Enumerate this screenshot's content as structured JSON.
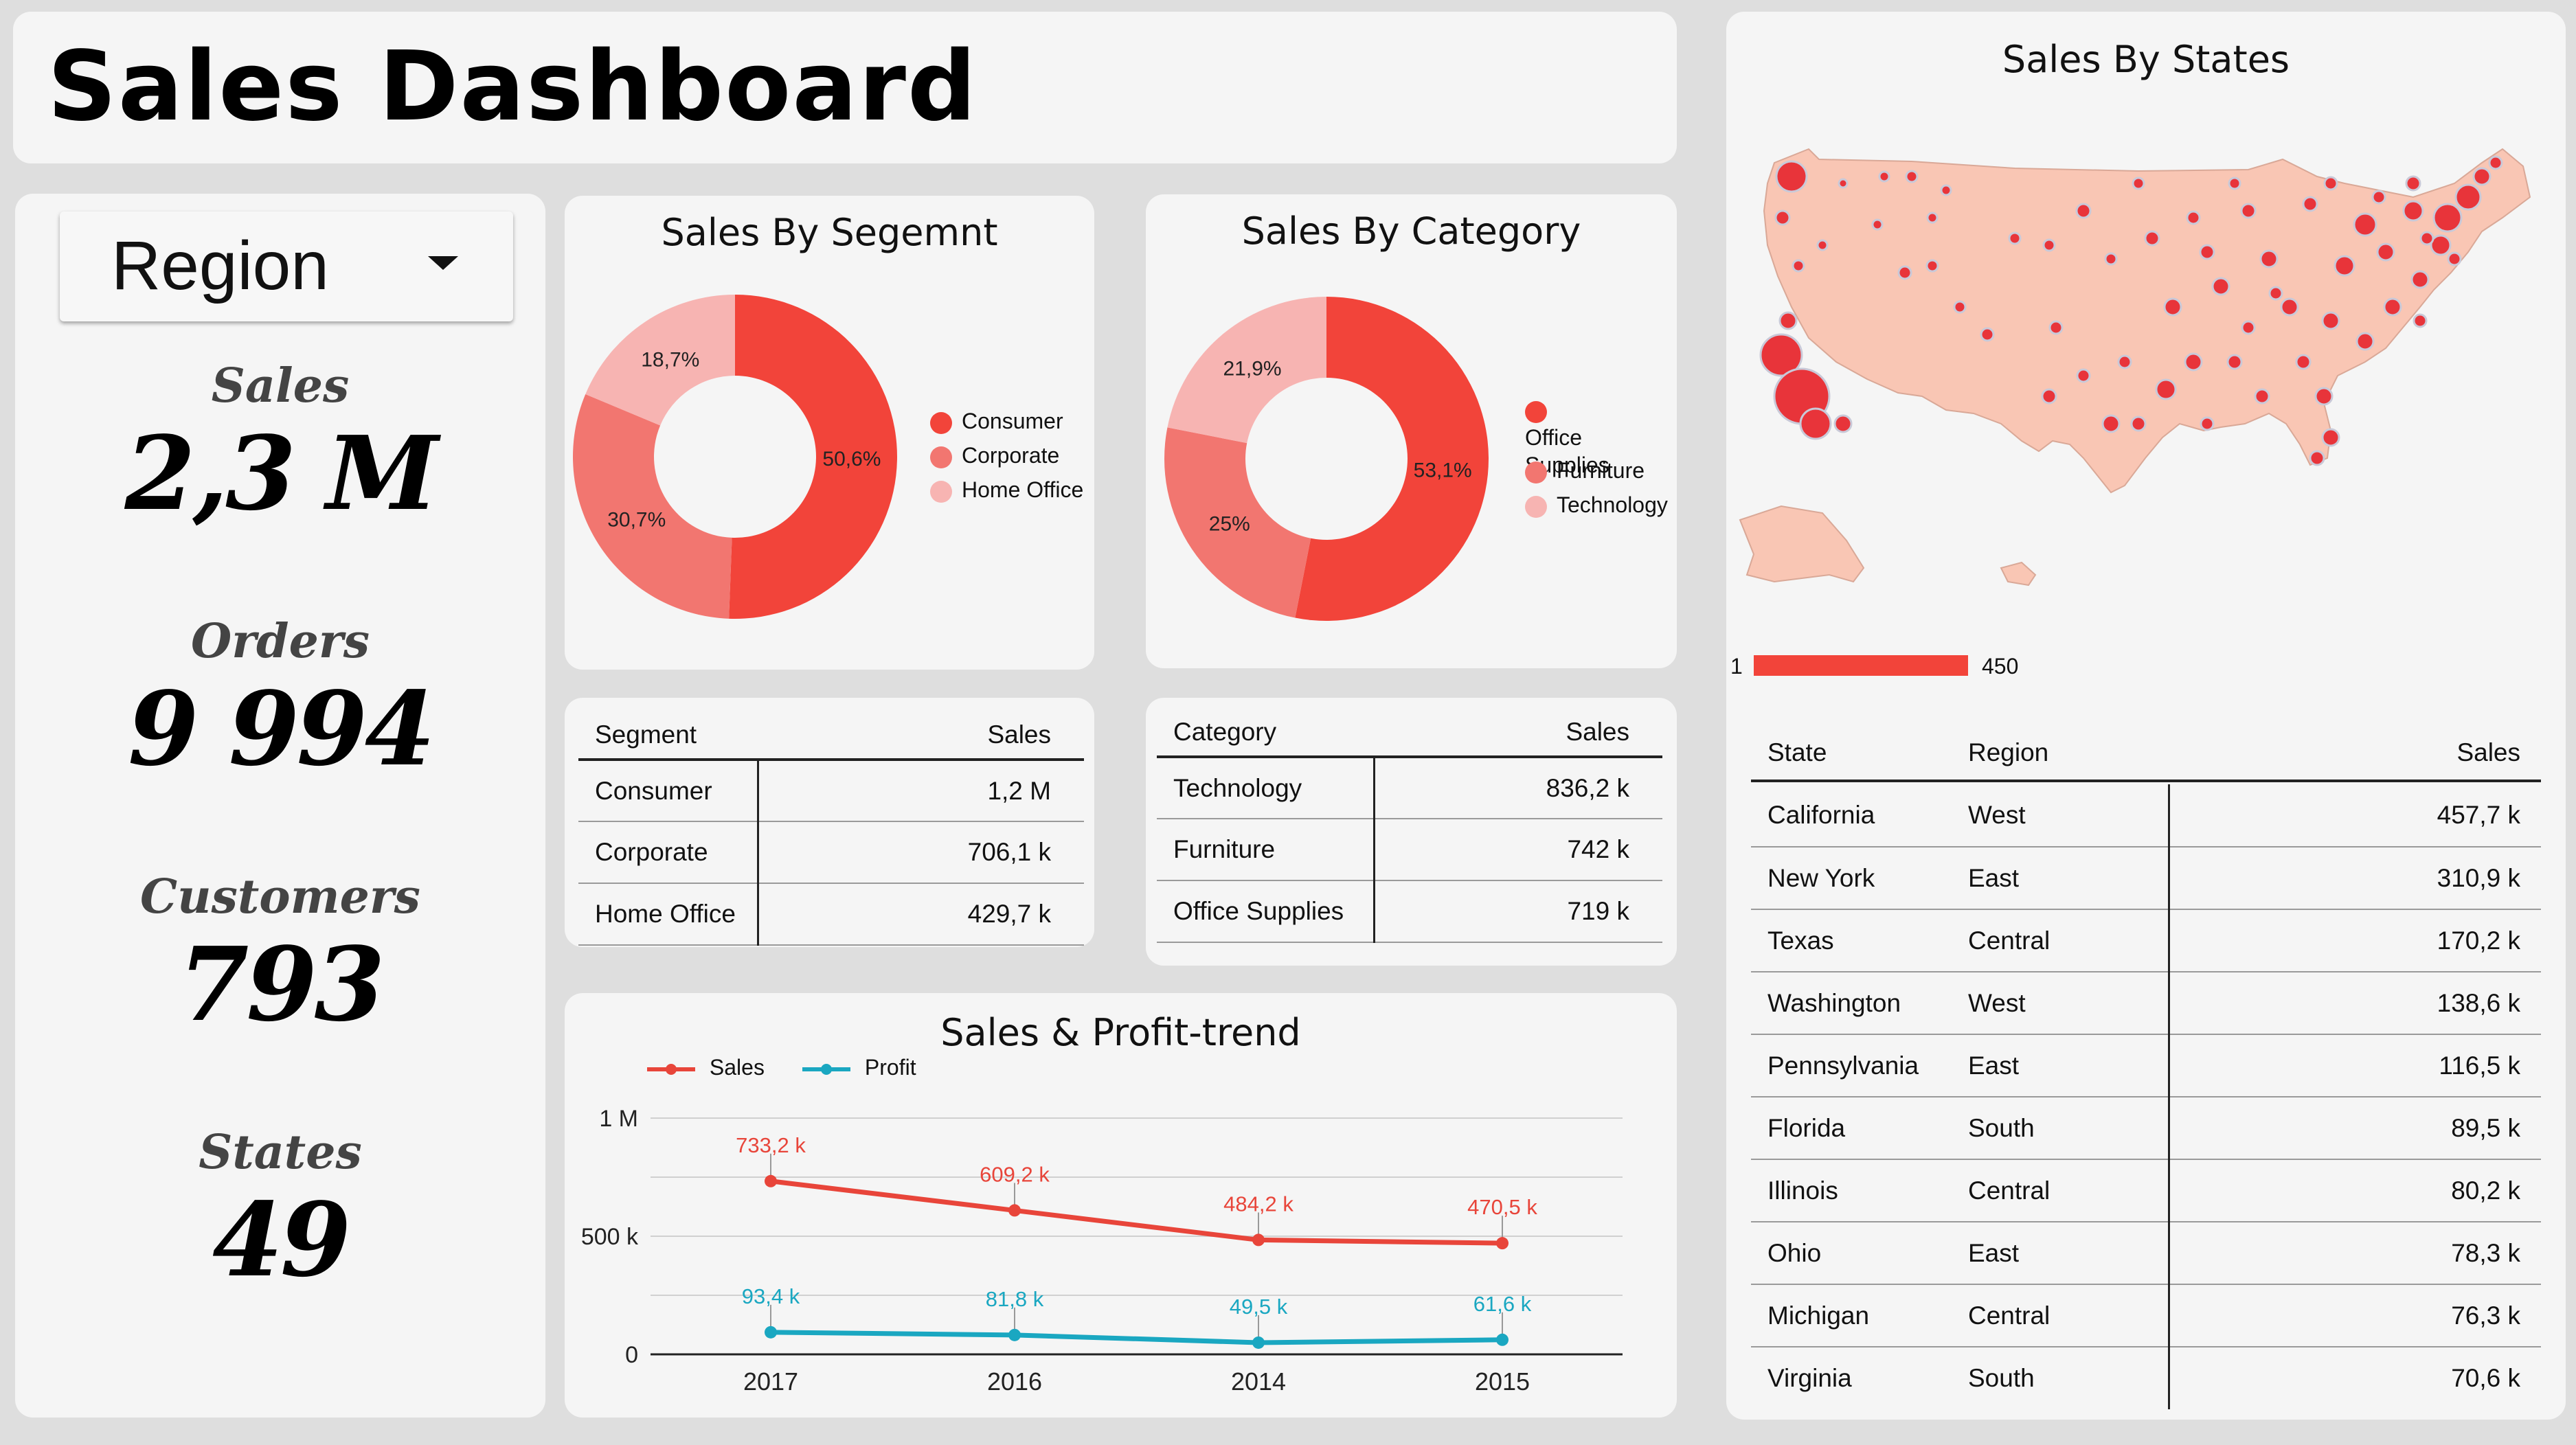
{
  "header": {
    "title": "Sales Dashboard"
  },
  "filter": {
    "label": "Region"
  },
  "kpis": [
    {
      "label": "Sales",
      "value": "2,3 M"
    },
    {
      "label": "Orders",
      "value": "9 994"
    },
    {
      "label": "Customers",
      "value": "793"
    },
    {
      "label": "States",
      "value": "49"
    }
  ],
  "segment_panel": {
    "title": "Sales By Segemnt",
    "legend": [
      "Consumer",
      "Corporate",
      "Home Office"
    ],
    "table": {
      "headers": [
        "Segment",
        "Sales"
      ],
      "rows": [
        [
          "Consumer",
          "1,2 M"
        ],
        [
          "Corporate",
          "706,1 k"
        ],
        [
          "Home Office",
          "429,7 k"
        ]
      ]
    }
  },
  "category_panel": {
    "title": "Sales By Category",
    "legend": [
      "Office Supplies",
      "Furniture",
      "Technology"
    ],
    "table": {
      "headers": [
        "Category",
        "Sales"
      ],
      "rows": [
        [
          "Technology",
          "836,2 k"
        ],
        [
          "Furniture",
          "742 k"
        ],
        [
          "Office Supplies",
          "719 k"
        ]
      ]
    }
  },
  "trend_panel": {
    "title": "Sales & Profit-trend",
    "legend": [
      "Sales",
      "Profit"
    ]
  },
  "map_panel": {
    "title": "Sales By States",
    "scale_min": "1",
    "scale_max": "450",
    "table": {
      "headers": [
        "State",
        "Region",
        "Sales"
      ],
      "rows": [
        [
          "California",
          "West",
          "457,7 k"
        ],
        [
          "New York",
          "East",
          "310,9 k"
        ],
        [
          "Texas",
          "Central",
          "170,2 k"
        ],
        [
          "Washington",
          "West",
          "138,6 k"
        ],
        [
          "Pennsylvania",
          "East",
          "116,5 k"
        ],
        [
          "Florida",
          "South",
          "89,5 k"
        ],
        [
          "Illinois",
          "Central",
          "80,2 k"
        ],
        [
          "Ohio",
          "East",
          "78,3 k"
        ],
        [
          "Michigan",
          "Central",
          "76,3 k"
        ],
        [
          "Virginia",
          "South",
          "70,6 k"
        ]
      ]
    }
  },
  "colors": {
    "consumer": "#f2443a",
    "corporate": "#f27670",
    "home_office": "#f7b4b2",
    "sales_line": "#e8453a",
    "profit_line": "#1aa7c1",
    "map_fill": "#f9c6b4",
    "map_dot": "#e8343a"
  },
  "chart_data": [
    {
      "type": "pie",
      "title": "Sales By Segemnt",
      "categories": [
        "Consumer",
        "Corporate",
        "Home Office"
      ],
      "values": [
        50.6,
        30.7,
        18.7
      ],
      "labels": [
        "50,6%",
        "30,7%",
        "18,7%"
      ],
      "colors": [
        "#f2443a",
        "#f27670",
        "#f7b4b2"
      ],
      "donut": true
    },
    {
      "type": "pie",
      "title": "Sales By Category",
      "categories": [
        "Office Supplies",
        "Furniture",
        "Technology"
      ],
      "values": [
        53.1,
        25,
        21.9
      ],
      "labels": [
        "53,1%",
        "25%",
        "21,9%"
      ],
      "colors": [
        "#f2443a",
        "#f27670",
        "#f7b4b2"
      ],
      "donut": true
    },
    {
      "type": "line",
      "title": "Sales & Profit-trend",
      "x": [
        "2017",
        "2016",
        "2014",
        "2015"
      ],
      "series": [
        {
          "name": "Sales",
          "values": [
            733.2,
            609.2,
            484.2,
            470.5
          ],
          "labels": [
            "733,2 k",
            "609,2 k",
            "484,2 k",
            "470,5 k"
          ],
          "color": "#e8453a"
        },
        {
          "name": "Profit",
          "values": [
            93.4,
            81.8,
            49.5,
            61.6
          ],
          "labels": [
            "93,4 k",
            "81,8 k",
            "49,5 k",
            "61,6 k"
          ],
          "color": "#1aa7c1"
        }
      ],
      "yticks": [
        "0",
        "500 k",
        "1 M"
      ],
      "ylim": [
        0,
        1000
      ],
      "grid": true,
      "legend": "top-left"
    }
  ]
}
